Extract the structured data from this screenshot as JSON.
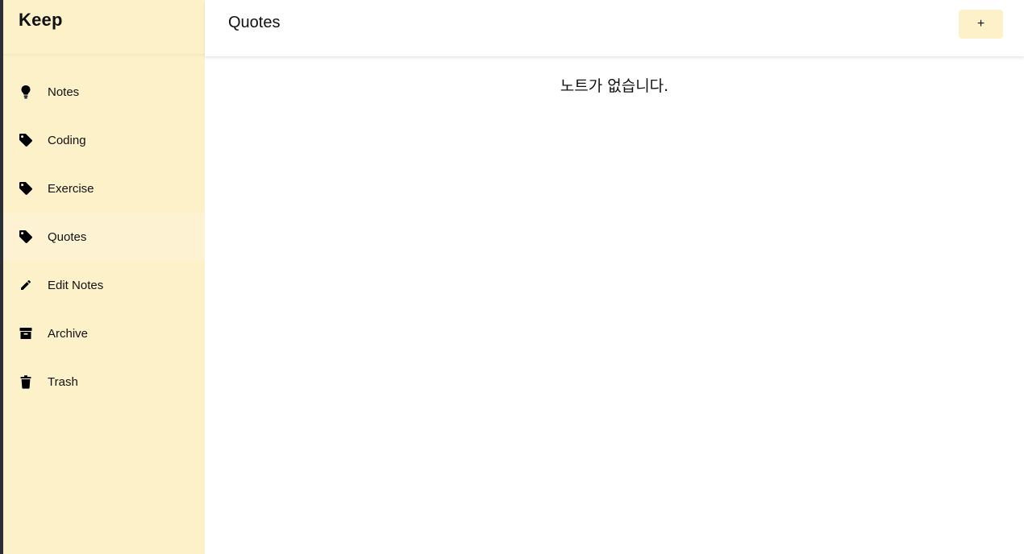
{
  "app": {
    "brand": "Keep"
  },
  "sidebar": {
    "items": [
      {
        "label": "Notes",
        "icon": "lightbulb-icon"
      },
      {
        "label": "Coding",
        "icon": "tag-icon"
      },
      {
        "label": "Exercise",
        "icon": "tag-icon"
      },
      {
        "label": "Quotes",
        "icon": "tag-icon",
        "active": true
      },
      {
        "label": "Edit Notes",
        "icon": "pencil-icon"
      },
      {
        "label": "Archive",
        "icon": "archive-icon"
      },
      {
        "label": "Trash",
        "icon": "trash-icon"
      }
    ]
  },
  "header": {
    "title": "Quotes",
    "add_label": "+"
  },
  "main": {
    "empty_message": "노트가 없습니다."
  },
  "colors": {
    "sidebar_bg": "#fdf1c9",
    "active_item_bg": "#fdf3d2",
    "button_bg": "#fdf1c9",
    "text": "#111111"
  }
}
